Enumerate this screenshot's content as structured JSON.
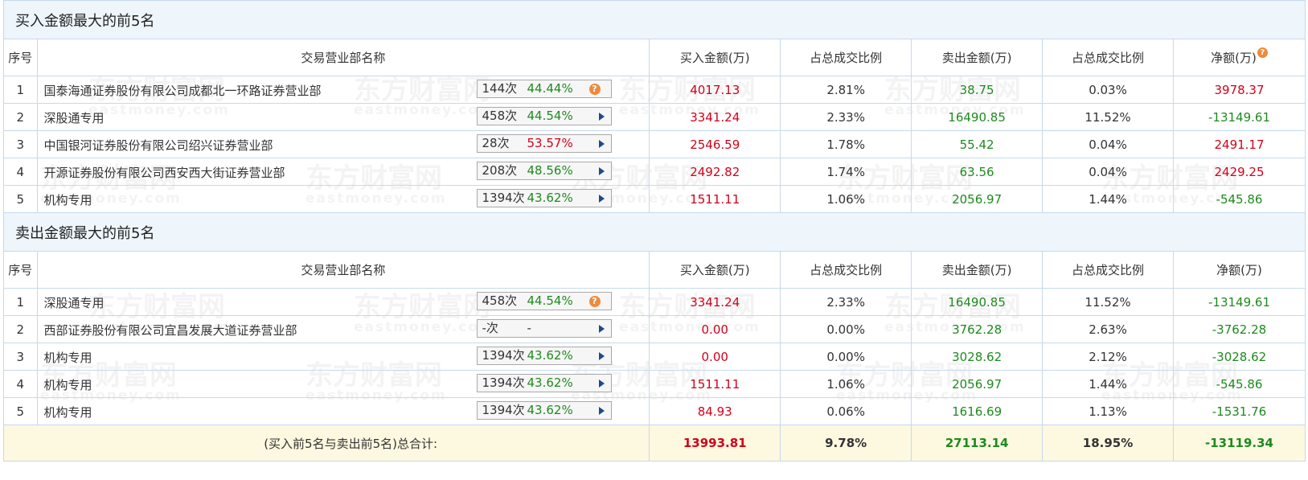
{
  "watermark": {
    "cn": "东方财富网",
    "en": "eastmoney.com"
  },
  "sections": [
    {
      "title": "买入金额最大的前5名",
      "headers": [
        "序号",
        "交易营业部名称",
        "买入金额(万)",
        "占总成交比例",
        "卖出金额(万)",
        "占总成交比例",
        "净额(万)"
      ],
      "net_header_help": true,
      "rows": [
        {
          "idx": "1",
          "name": "国泰海通证券股份有限公司成都北一环路证券营业部",
          "count": "144次",
          "pct": "44.44%",
          "pct_color": "green",
          "tag_icon": "help",
          "buy": "4017.13",
          "buy_ratio": "2.81%",
          "sell": "38.75",
          "sell_ratio": "0.03%",
          "net": "3978.37",
          "net_color": "red"
        },
        {
          "idx": "2",
          "name": "深股通专用",
          "count": "458次",
          "pct": "44.54%",
          "pct_color": "green",
          "tag_icon": "arrow",
          "buy": "3341.24",
          "buy_ratio": "2.33%",
          "sell": "16490.85",
          "sell_ratio": "11.52%",
          "net": "-13149.61",
          "net_color": "green"
        },
        {
          "idx": "3",
          "name": "中国银河证券股份有限公司绍兴证券营业部",
          "count": "28次",
          "pct": "53.57%",
          "pct_color": "red",
          "tag_icon": "arrow",
          "buy": "2546.59",
          "buy_ratio": "1.78%",
          "sell": "55.42",
          "sell_ratio": "0.04%",
          "net": "2491.17",
          "net_color": "red"
        },
        {
          "idx": "4",
          "name": "开源证券股份有限公司西安西大街证券营业部",
          "count": "208次",
          "pct": "48.56%",
          "pct_color": "green",
          "tag_icon": "arrow",
          "buy": "2492.82",
          "buy_ratio": "1.74%",
          "sell": "63.56",
          "sell_ratio": "0.04%",
          "net": "2429.25",
          "net_color": "red"
        },
        {
          "idx": "5",
          "name": "机构专用",
          "count": "1394次",
          "pct": "43.62%",
          "pct_color": "green",
          "tag_icon": "arrow",
          "buy": "1511.11",
          "buy_ratio": "1.06%",
          "sell": "2056.97",
          "sell_ratio": "1.44%",
          "net": "-545.86",
          "net_color": "green"
        }
      ]
    },
    {
      "title": "卖出金额最大的前5名",
      "headers": [
        "序号",
        "交易营业部名称",
        "买入金额(万)",
        "占总成交比例",
        "卖出金额(万)",
        "占总成交比例",
        "净额(万)"
      ],
      "net_header_help": false,
      "rows": [
        {
          "idx": "1",
          "name": "深股通专用",
          "count": "458次",
          "pct": "44.54%",
          "pct_color": "green",
          "tag_icon": "help",
          "buy": "3341.24",
          "buy_ratio": "2.33%",
          "sell": "16490.85",
          "sell_ratio": "11.52%",
          "net": "-13149.61",
          "net_color": "green"
        },
        {
          "idx": "2",
          "name": "西部证券股份有限公司宜昌发展大道证券营业部",
          "count": "-次",
          "pct": "-",
          "pct_color": "dark",
          "tag_icon": "arrow",
          "buy": "0.00",
          "buy_ratio": "0.00%",
          "sell": "3762.28",
          "sell_ratio": "2.63%",
          "net": "-3762.28",
          "net_color": "green"
        },
        {
          "idx": "3",
          "name": "机构专用",
          "count": "1394次",
          "pct": "43.62%",
          "pct_color": "green",
          "tag_icon": "arrow",
          "buy": "0.00",
          "buy_ratio": "0.00%",
          "sell": "3028.62",
          "sell_ratio": "2.12%",
          "net": "-3028.62",
          "net_color": "green"
        },
        {
          "idx": "4",
          "name": "机构专用",
          "count": "1394次",
          "pct": "43.62%",
          "pct_color": "green",
          "tag_icon": "arrow",
          "buy": "1511.11",
          "buy_ratio": "1.06%",
          "sell": "2056.97",
          "sell_ratio": "1.44%",
          "net": "-545.86",
          "net_color": "green"
        },
        {
          "idx": "5",
          "name": "机构专用",
          "count": "1394次",
          "pct": "43.62%",
          "pct_color": "green",
          "tag_icon": "arrow",
          "buy": "84.93",
          "buy_ratio": "0.06%",
          "sell": "1616.69",
          "sell_ratio": "1.13%",
          "net": "-1531.76",
          "net_color": "green"
        }
      ]
    }
  ],
  "total": {
    "label": "(买入前5名与卖出前5名)总合计:",
    "buy": "13993.81",
    "buy_ratio": "9.78%",
    "sell": "27113.14",
    "sell_ratio": "18.95%",
    "net": "-13119.34"
  },
  "colors": {
    "red": "#d0021b",
    "green": "#1f8a1f",
    "title_bg": "#eef5fb",
    "total_bg": "#fdf8e0",
    "border": "#c6d9ec",
    "help_badge": "#ef8a3c",
    "arrow": "#1a4b8c"
  },
  "icons": {
    "help": "question-badge-icon",
    "arrow": "play-arrow-icon"
  }
}
